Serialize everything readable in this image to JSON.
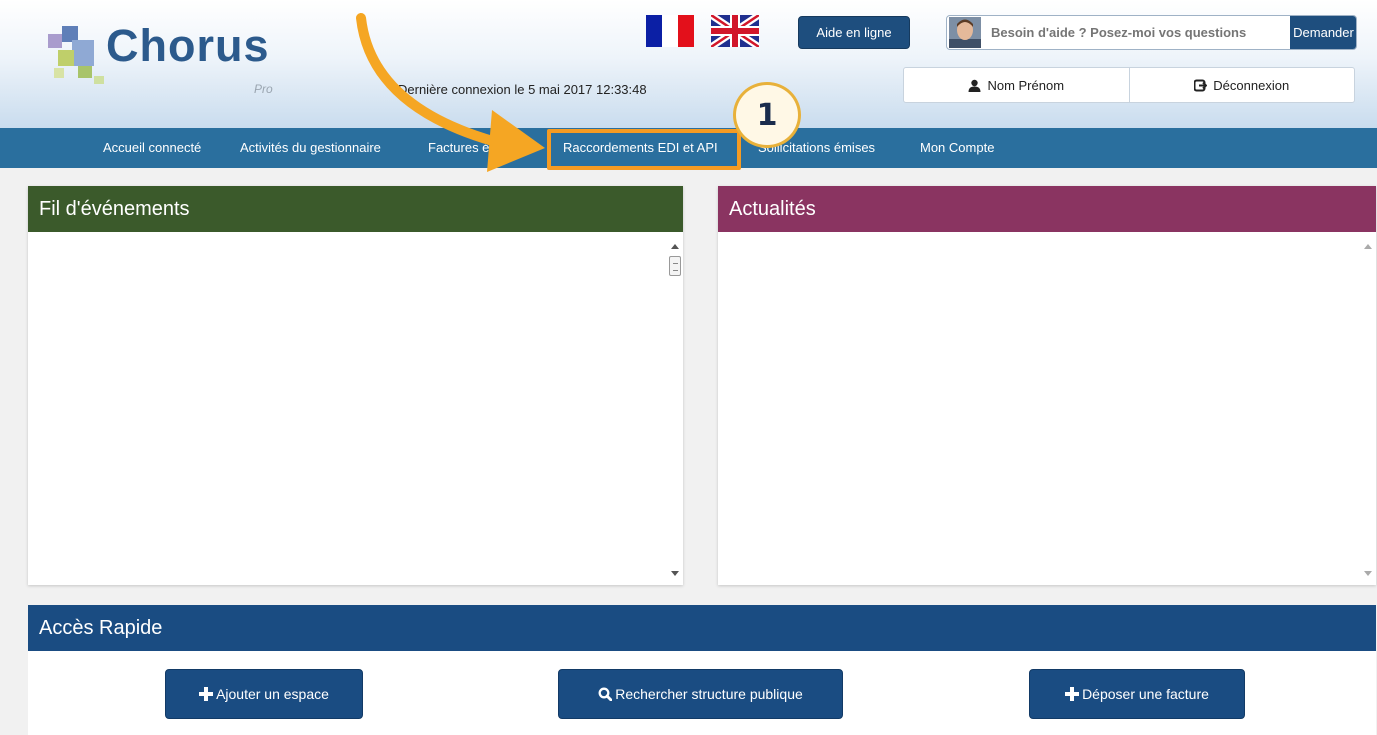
{
  "header": {
    "logo": {
      "name": "Chorus",
      "sub": "Pro"
    },
    "last_login": "Dernière connexion le 5 mai 2017 12:33:48",
    "help_button": "Aide en ligne",
    "chat": {
      "placeholder": "Besoin d'aide ? Posez-moi vos questions",
      "button": "Demander"
    },
    "user": {
      "name": "Nom Prénom",
      "logout": "Déconnexion"
    }
  },
  "nav": {
    "items": [
      {
        "label": "Accueil connecté"
      },
      {
        "label": "Activités du gestionnaire"
      },
      {
        "label": "Factures émises"
      },
      {
        "label": "Raccordements EDI et API"
      },
      {
        "label": "Sollicitations émises"
      },
      {
        "label": "Mon Compte"
      }
    ]
  },
  "annotation": {
    "step": "1",
    "color": "#f59b23"
  },
  "panels": {
    "events": {
      "title": "Fil d'événements",
      "color": "#3b5a2b"
    },
    "news": {
      "title": "Actualités",
      "color": "#8a3461"
    }
  },
  "quick_access": {
    "title": "Accès Rapide",
    "buttons": [
      {
        "icon": "plus-icon",
        "label": "Ajouter un espace"
      },
      {
        "icon": "search-icon",
        "label": "Rechercher structure publique"
      },
      {
        "icon": "plus-icon",
        "label": "Déposer une facture"
      }
    ]
  }
}
